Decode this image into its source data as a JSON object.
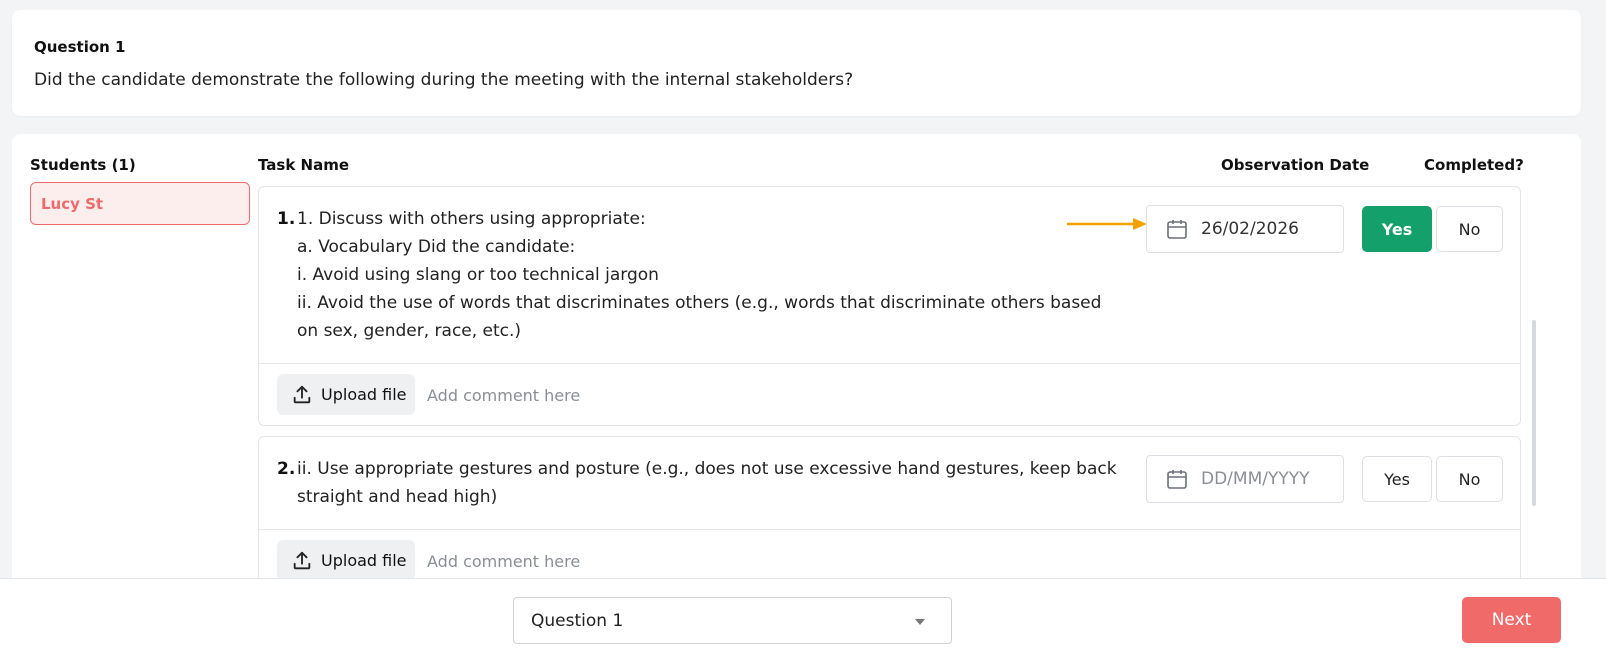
{
  "question": {
    "label": "Question 1",
    "text": "Did the candidate demonstrate the following during the meeting with the internal stakeholders?"
  },
  "columns": {
    "students": "Students (1)",
    "task_name": "Task Name",
    "observation_date": "Observation Date",
    "completed": "Completed?"
  },
  "students": [
    {
      "name": "Lucy St",
      "selected": true
    }
  ],
  "tasks": [
    {
      "number": "1.",
      "lines": [
        "1. Discuss with others using appropriate:",
        "a. Vocabulary Did the candidate:",
        "i. Avoid using slang or too technical jargon",
        "ii. Avoid the use of words that discriminates others (e.g., words that discriminate others based on sex, gender, race, etc.)"
      ],
      "date_value": "26/02/2026",
      "date_placeholder": "DD/MM/YYYY",
      "yes_label": "Yes",
      "no_label": "No",
      "completed": "Yes",
      "upload_label": "Upload file",
      "comment_placeholder": "Add comment here"
    },
    {
      "number": "2.",
      "lines": [
        "ii. Use appropriate gestures and posture (e.g., does not use excessive hand gestures, keep back straight and head high)"
      ],
      "date_value": "",
      "date_placeholder": "DD/MM/YYYY",
      "yes_label": "Yes",
      "no_label": "No",
      "completed": "",
      "upload_label": "Upload file",
      "comment_placeholder": "Add comment here"
    }
  ],
  "footer": {
    "question_select": "Question 1",
    "next_label": "Next"
  },
  "colors": {
    "accent_red": "#f16a6a",
    "yes_green": "#14a06a",
    "arrow_orange": "#f5a000"
  },
  "icons": [
    "calendar-icon",
    "upload-icon",
    "arrow-right-icon",
    "chevron-down-icon"
  ]
}
